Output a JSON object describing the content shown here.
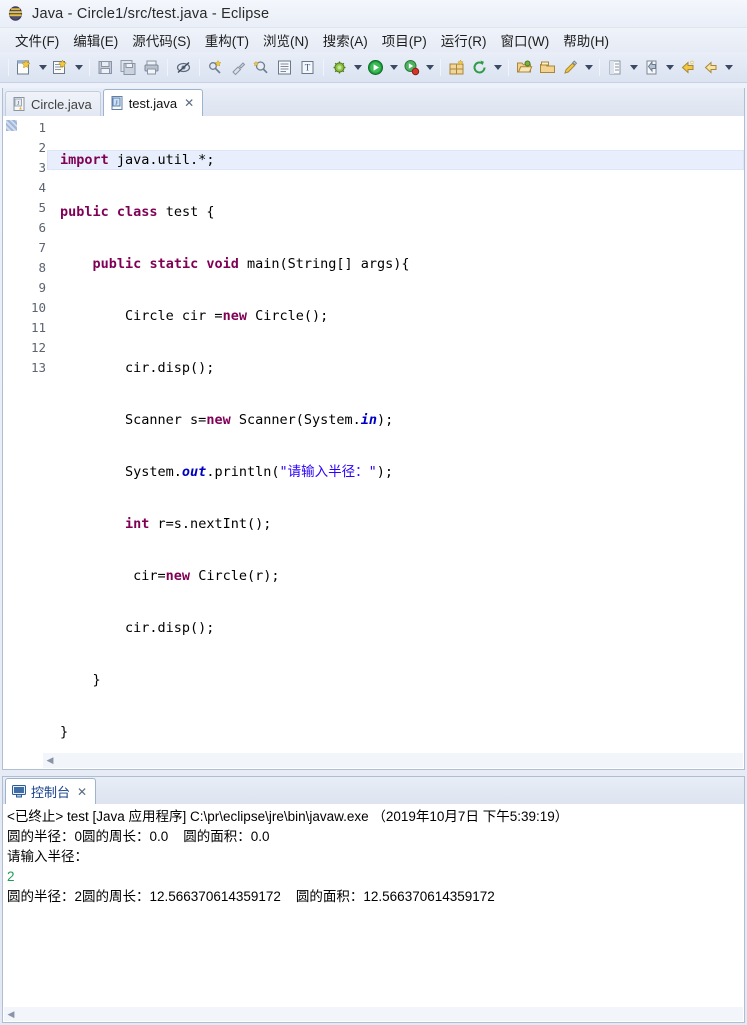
{
  "window": {
    "title": "Java - Circle1/src/test.java - Eclipse",
    "logo_icon": "eclipse-logo-icon"
  },
  "menubar": {
    "items": [
      {
        "label": "文件(F)"
      },
      {
        "label": "编辑(E)"
      },
      {
        "label": "源代码(S)"
      },
      {
        "label": "重构(T)"
      },
      {
        "label": "浏览(N)"
      },
      {
        "label": "搜索(A)"
      },
      {
        "label": "项目(P)"
      },
      {
        "label": "运行(R)"
      },
      {
        "label": "窗口(W)"
      },
      {
        "label": "帮助(H)"
      }
    ]
  },
  "toolbar": {
    "groups": [
      {
        "buttons": [
          {
            "icon": "new-wizard-icon",
            "dropdown": true
          },
          {
            "icon": "new-java-class-icon",
            "dropdown": true
          }
        ]
      },
      {
        "buttons": [
          {
            "icon": "save-icon",
            "dropdown": false
          },
          {
            "icon": "save-all-icon",
            "dropdown": false
          },
          {
            "icon": "print-icon",
            "dropdown": false
          }
        ]
      },
      {
        "buttons": [
          {
            "icon": "toggle-mark-occurrences-icon",
            "dropdown": false
          }
        ]
      },
      {
        "buttons": [
          {
            "icon": "new-annotation-icon",
            "dropdown": false
          },
          {
            "icon": "build-icon",
            "dropdown": false
          },
          {
            "icon": "search-icon",
            "dropdown": false
          },
          {
            "icon": "open-task-icon",
            "dropdown": false
          },
          {
            "icon": "open-type-icon",
            "dropdown": false
          }
        ]
      },
      {
        "buttons": [
          {
            "icon": "debug-run-icon",
            "dropdown": true
          },
          {
            "icon": "run-icon",
            "dropdown": true
          },
          {
            "icon": "coverage-icon",
            "dropdown": true
          }
        ]
      },
      {
        "buttons": [
          {
            "icon": "new-java-project-icon",
            "dropdown": false
          },
          {
            "icon": "refresh-icon",
            "dropdown": true
          }
        ]
      },
      {
        "buttons": [
          {
            "icon": "open-folder-icon",
            "dropdown": false
          },
          {
            "icon": "open-package-icon",
            "dropdown": false
          },
          {
            "icon": "external-tools-icon",
            "dropdown": true
          }
        ]
      },
      {
        "buttons": [
          {
            "icon": "next-annotation-icon",
            "dropdown": true
          },
          {
            "icon": "last-edit-location-icon",
            "dropdown": true
          }
        ]
      },
      {
        "buttons": [
          {
            "icon": "back-icon",
            "dropdown": false
          },
          {
            "icon": "forward-icon",
            "dropdown": true
          }
        ]
      }
    ]
  },
  "editor": {
    "tabs": [
      {
        "label": "Circle.java",
        "active": false,
        "closable": false,
        "icon": "java-file-icon"
      },
      {
        "label": "test.java",
        "active": true,
        "closable": true,
        "close_glyph": "✕",
        "icon": "java-file-icon"
      }
    ],
    "line_numbers": [
      "1",
      "2",
      "3",
      "4",
      "5",
      "6",
      "7",
      "8",
      "9",
      "10",
      "11",
      "12",
      "13"
    ],
    "fold_markers": {
      "3": "⊖"
    },
    "current_line": 1,
    "code_html": [
      "<span class=\"kw\">import</span> java.util.*;",
      "<span class=\"kw\">public</span> <span class=\"kw\">class</span> test {",
      "    <span class=\"kw\">public</span> <span class=\"kw\">static</span> <span class=\"kw\">void</span> main(String[] args){",
      "        Circle cir =<span class=\"kw\">new</span> Circle();",
      "        cir.disp();",
      "        Scanner s=<span class=\"kw\">new</span> Scanner(System.<span class=\"stat\">in</span>);",
      "        System.<span class=\"stat\">out</span>.println(<span class=\"str\">\"请输入半径：\"</span>);",
      "        <span class=\"kw\">int</span> r=s.nextInt();",
      "         cir=<span class=\"kw\">new</span> Circle(r);",
      "        cir.disp();",
      "    }",
      "}",
      ""
    ],
    "code_plain": [
      "import java.util.*;",
      "public class test {",
      "    public static void main(String[] args){",
      "        Circle cir =new Circle();",
      "        cir.disp();",
      "        Scanner s=new Scanner(System.in);",
      "        System.out.println(\"请输入半径：\");",
      "        int r=s.nextInt();",
      "         cir=new Circle(r);",
      "        cir.disp();",
      "    }",
      "}",
      ""
    ],
    "scroll_left_glyph": "◀"
  },
  "console": {
    "tab_label": "控制台",
    "tab_icon": "console-icon",
    "tab_close_glyph": "✕",
    "lines": [
      {
        "text": "<已终止> test [Java 应用程序] C:\\pr\\eclipse\\jre\\bin\\javaw.exe （2019年10月7日 下午5:39:19）",
        "type": "header"
      },
      {
        "text": "圆的半径：0圆的周长：0.0    圆的面积：0.0",
        "type": "output"
      },
      {
        "text": "请输入半径：",
        "type": "output"
      },
      {
        "text": "2",
        "type": "input"
      },
      {
        "text": "圆的半径：2圆的周长：12.566370614359172    圆的面积：12.566370614359172",
        "type": "output"
      }
    ],
    "scroll_left_glyph": "◀"
  },
  "colors": {
    "keyword": "#7f0055",
    "string": "#2a00ff",
    "static_field": "#0000c0",
    "console_input": "#1f9b53",
    "current_line_bg": "#e8eefb",
    "chrome": "#e3e9f4"
  }
}
